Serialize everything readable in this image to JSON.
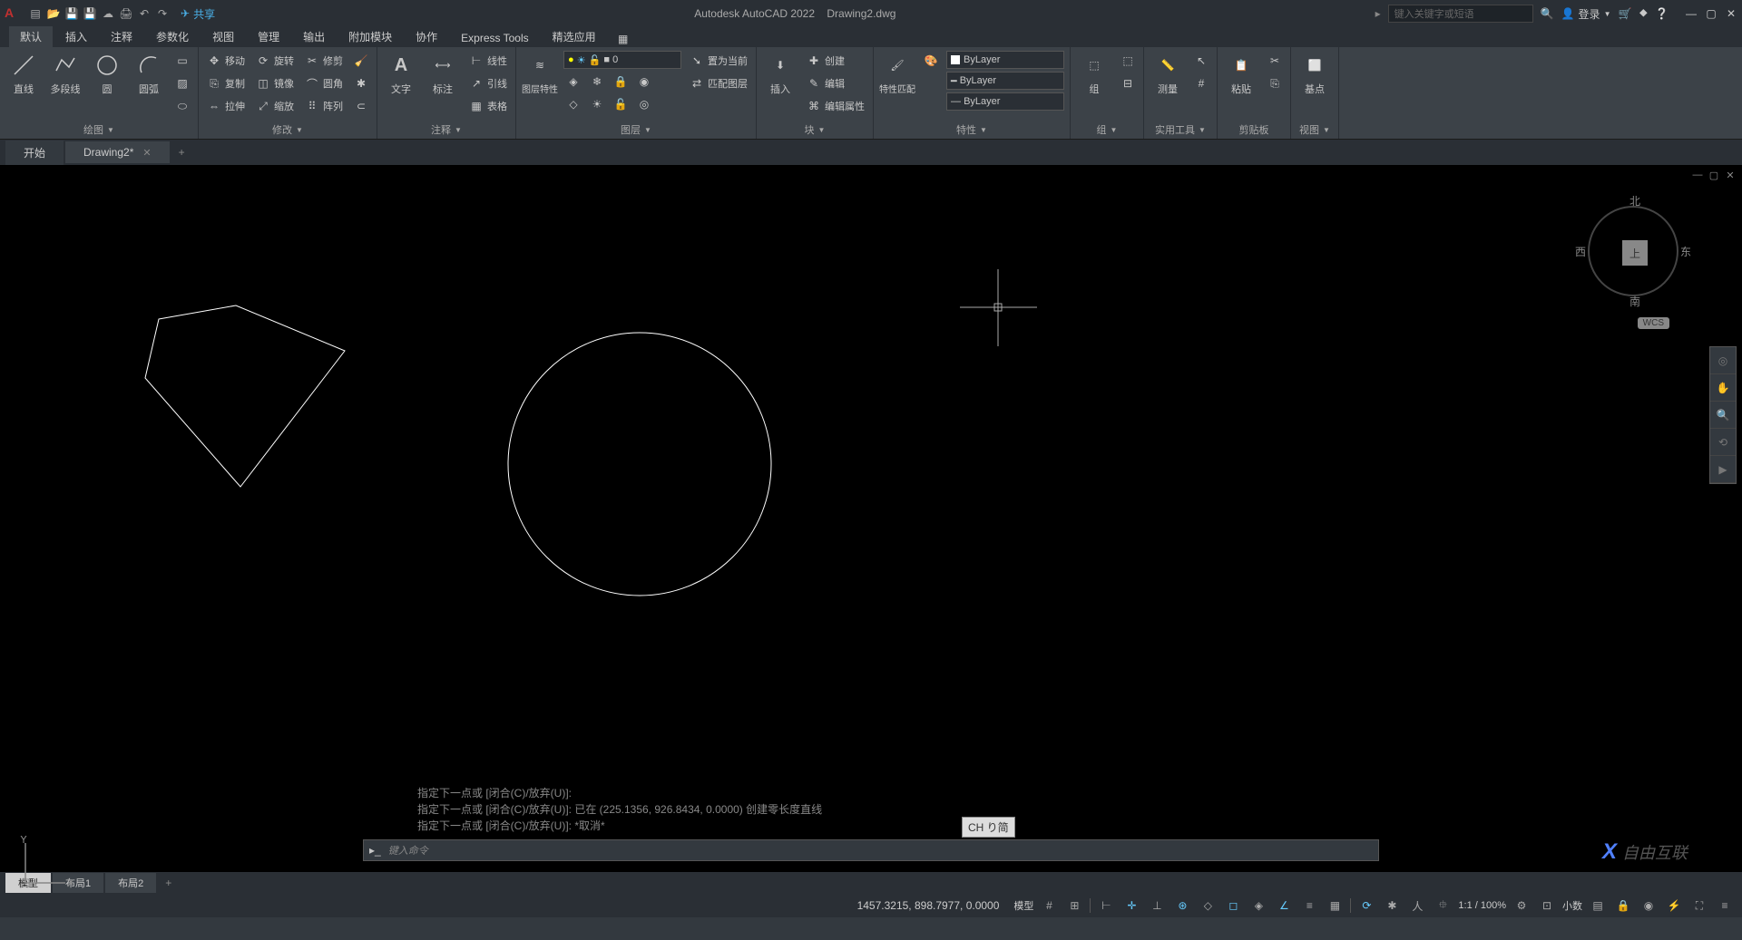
{
  "app": {
    "title": "Autodesk AutoCAD 2022",
    "file": "Drawing2.dwg"
  },
  "qat": {
    "share": "共享"
  },
  "search": {
    "placeholder": "键入关键字或短语"
  },
  "login": {
    "label": "登录"
  },
  "menu_tabs": [
    "默认",
    "插入",
    "注释",
    "参数化",
    "视图",
    "管理",
    "输出",
    "附加模块",
    "协作",
    "Express Tools",
    "精选应用"
  ],
  "ribbon": {
    "draw": {
      "title": "绘图",
      "line": "直线",
      "polyline": "多段线",
      "circle": "圆",
      "arc": "圆弧"
    },
    "modify": {
      "title": "修改",
      "move": "移动",
      "rotate": "旋转",
      "trim": "修剪",
      "copy": "复制",
      "mirror": "镜像",
      "fillet": "圆角",
      "stretch": "拉伸",
      "scale": "缩放",
      "array": "阵列"
    },
    "annotation": {
      "title": "注释",
      "text": "文字",
      "dimension": "标注",
      "linear": "线性",
      "leader": "引线",
      "table": "表格"
    },
    "layers": {
      "title": "图层",
      "props": "图层特性",
      "setcurrent": "置为当前",
      "match": "匹配图层",
      "combo": "0"
    },
    "block": {
      "title": "块",
      "insert": "插入",
      "create": "创建",
      "edit": "编辑",
      "editattrib": "编辑属性"
    },
    "properties": {
      "title": "特性",
      "match": "特性匹配",
      "bylayer": "ByLayer"
    },
    "group": {
      "title": "组",
      "label": "组"
    },
    "utilities": {
      "title": "实用工具",
      "label": "测量"
    },
    "clipboard": {
      "title": "剪贴板",
      "label": "粘贴"
    },
    "view": {
      "title": "视图",
      "label": "基点"
    }
  },
  "file_tabs": {
    "start": "开始",
    "drawing": "Drawing2*"
  },
  "compass": {
    "n": "北",
    "s": "南",
    "e": "东",
    "w": "西",
    "top": "上",
    "wcs": "WCS"
  },
  "cmd_history": [
    "指定下一点或 [闭合(C)/放弃(U)]:",
    "指定下一点或 [闭合(C)/放弃(U)]: 已在 (225.1356, 926.8434, 0.0000) 创建零长度直线",
    "指定下一点或 [闭合(C)/放弃(U)]: *取消*"
  ],
  "cmd": {
    "placeholder": "键入命令"
  },
  "ime": {
    "label": "CH り简"
  },
  "layout_tabs": [
    "模型",
    "布局1",
    "布局2"
  ],
  "status": {
    "coords": "1457.3215, 898.7977, 0.0000",
    "model": "模型",
    "scale": "1:1 / 100%",
    "decimal": "小数"
  },
  "watermark": {
    "text": "自由互联"
  }
}
